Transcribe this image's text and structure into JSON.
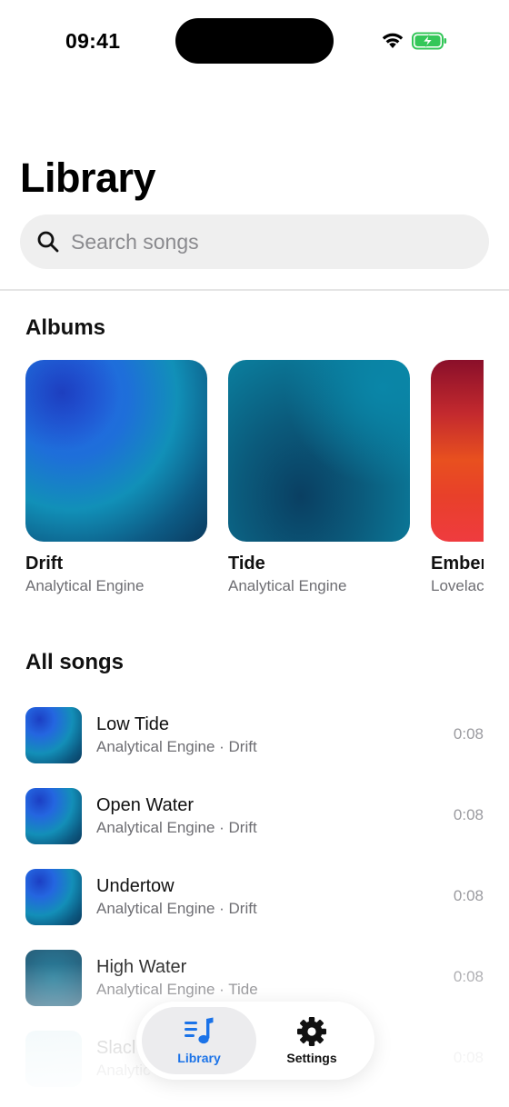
{
  "status_bar": {
    "time": "09:41"
  },
  "header": {
    "title": "Library"
  },
  "search": {
    "placeholder": "Search songs"
  },
  "albums": {
    "title": "Albums",
    "items": [
      {
        "name": "Drift",
        "artist": "Analytical Engine"
      },
      {
        "name": "Tide",
        "artist": "Analytical Engine"
      },
      {
        "name": "Ember",
        "artist": "Lovelac"
      }
    ]
  },
  "songs": {
    "title": "All songs",
    "items": [
      {
        "title": "Low Tide",
        "subtitle": "Analytical Engine · Drift",
        "duration": "0:08"
      },
      {
        "title": "Open Water",
        "subtitle": "Analytical Engine · Drift",
        "duration": "0:08"
      },
      {
        "title": "Undertow",
        "subtitle": "Analytical Engine · Drift",
        "duration": "0:08"
      },
      {
        "title": "High Water",
        "subtitle": "Analytical Engine · Tide",
        "duration": "0:08"
      },
      {
        "title": "Slacl",
        "subtitle": "Analytic",
        "duration": "0:08"
      }
    ]
  },
  "tab_bar": {
    "tabs": [
      {
        "label": "Library",
        "icon": "music-list-icon",
        "active": true
      },
      {
        "label": "Settings",
        "icon": "gear-icon",
        "active": false
      }
    ]
  },
  "colors": {
    "accent": "#1b73e8"
  }
}
